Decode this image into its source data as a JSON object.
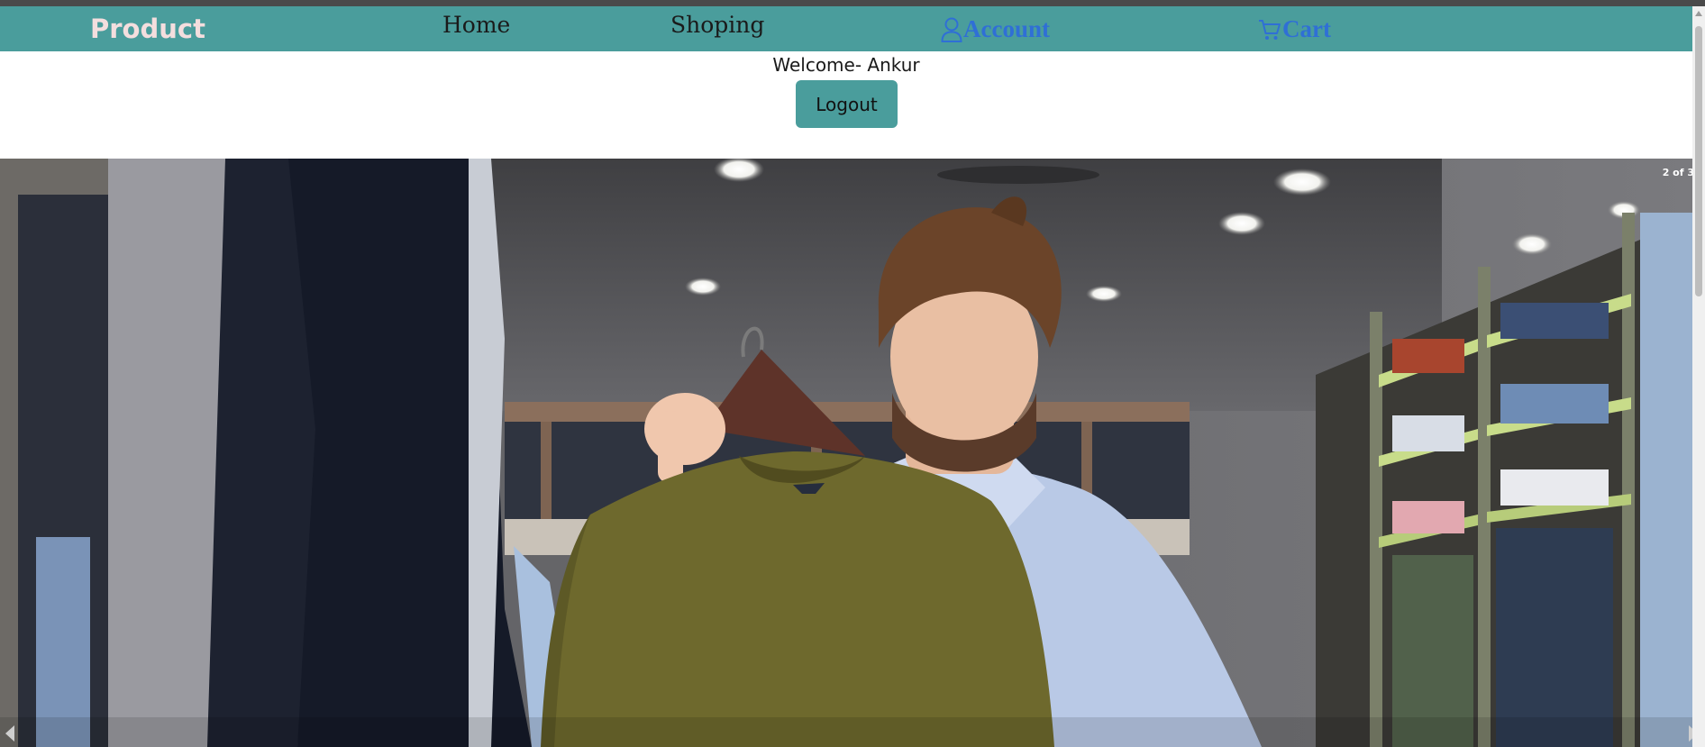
{
  "navbar": {
    "brand": "Product",
    "links": {
      "home": "Home",
      "shopping": "Shoping",
      "account": "Account",
      "cart": "Cart"
    },
    "background_color": "#4a9d9c",
    "accent_link_color": "#2f6fd6"
  },
  "welcome": {
    "text": "Welcome- Ankur"
  },
  "logout_button": {
    "label": "Logout",
    "background_color": "#4a9d9c"
  },
  "carousel": {
    "slide_counter": "2 of 3",
    "current_slide": 2,
    "total_slides": 3,
    "slide_image": "man-holding-olive-sweater-in-clothing-store",
    "prev_icon": "triangle-left",
    "next_icon": "triangle-right"
  },
  "icons": {
    "account": "user-icon",
    "cart": "cart-icon"
  }
}
